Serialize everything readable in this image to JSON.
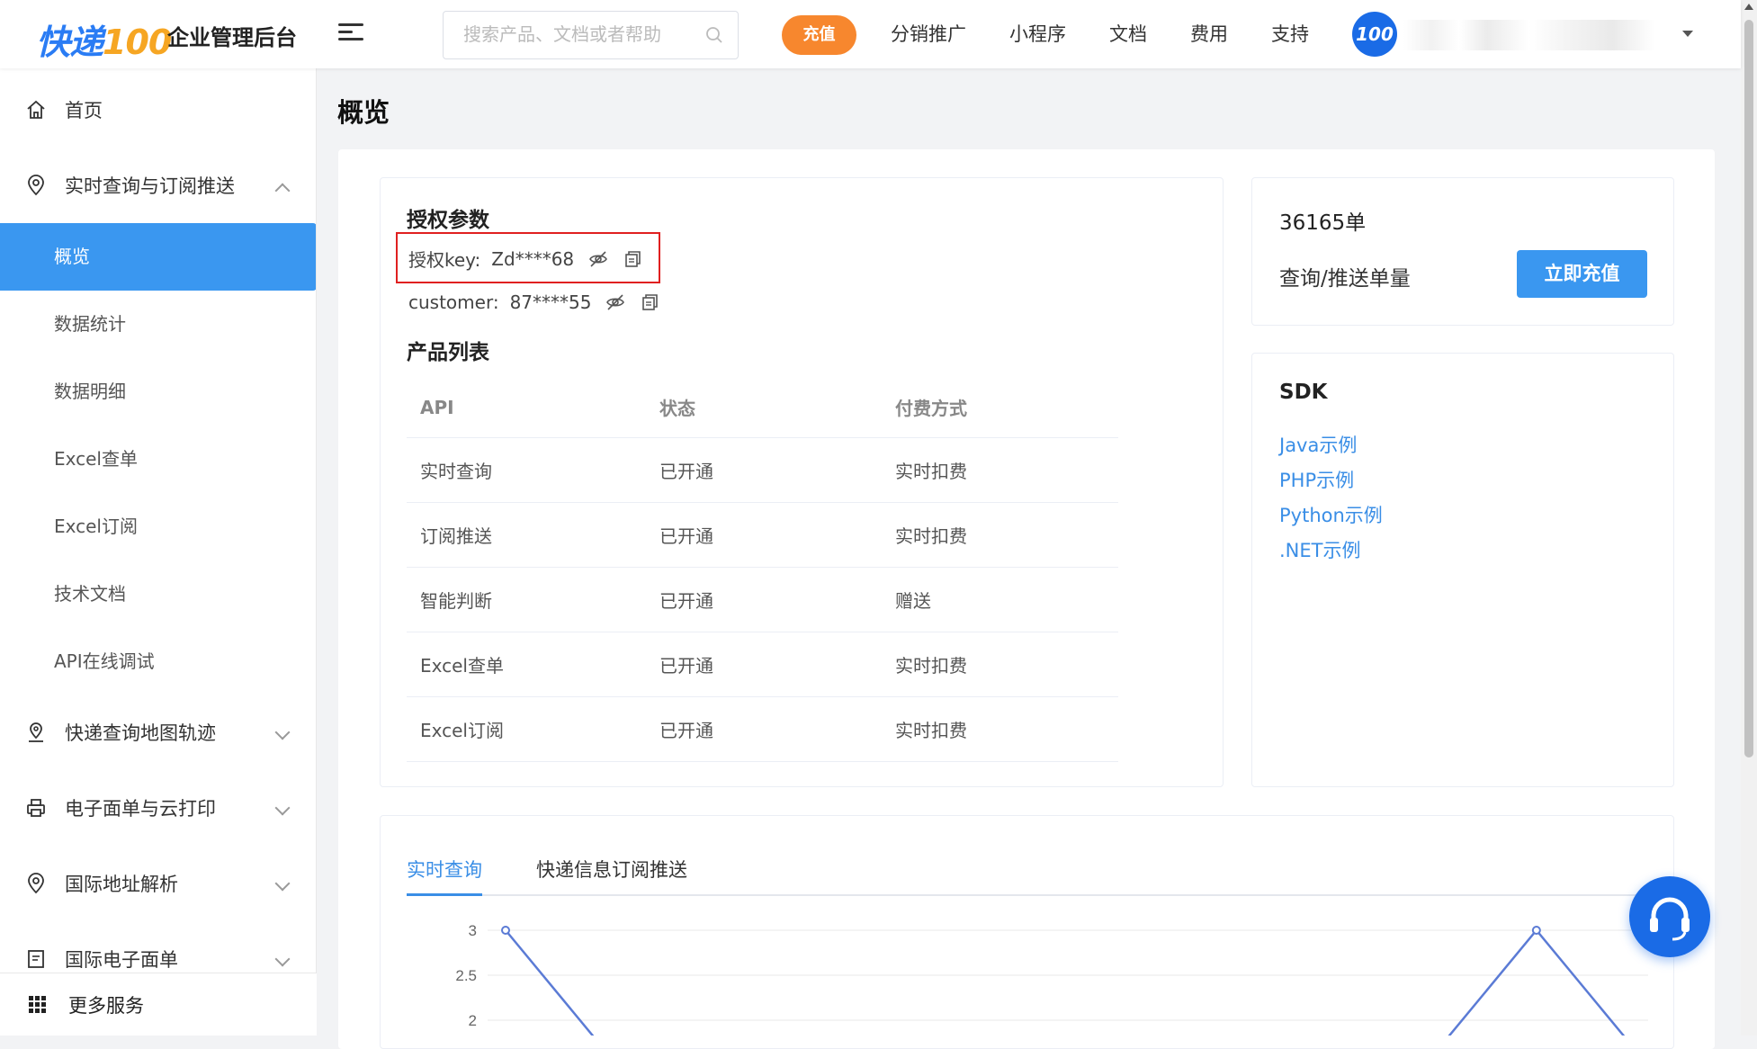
{
  "header": {
    "logo_main": "快递",
    "logo_num": "100",
    "app_title": "企业管理后台",
    "search_placeholder": "搜索产品、文档或者帮助",
    "recharge_label": "充值",
    "nav": [
      "分销推广",
      "小程序",
      "文档",
      "费用",
      "支持"
    ],
    "avatar_text": "100"
  },
  "sidebar": {
    "home": "首页",
    "section_realtime": "实时查询与订阅推送",
    "sub_items": [
      "概览",
      "数据统计",
      "数据明细",
      "Excel查单",
      "Excel订阅",
      "技术文档",
      "API在线调试"
    ],
    "section_map": "快递查询地图轨迹",
    "section_print": "电子面单与云打印",
    "section_intl_addr": "国际地址解析",
    "section_intl_waybill": "国际电子面单",
    "more_services": "更多服务"
  },
  "page": {
    "title": "概览"
  },
  "auth": {
    "title": "授权参数",
    "key_label": "授权key:",
    "key_value": "Zd****68",
    "customer_label": "customer:",
    "customer_value": "87****55"
  },
  "products": {
    "title": "产品列表",
    "columns": [
      "API",
      "状态",
      "付费方式"
    ],
    "rows": [
      [
        "实时查询",
        "已开通",
        "实时扣费"
      ],
      [
        "订阅推送",
        "已开通",
        "实时扣费"
      ],
      [
        "智能判断",
        "已开通",
        "赠送"
      ],
      [
        "Excel查单",
        "已开通",
        "实时扣费"
      ],
      [
        "Excel订阅",
        "已开通",
        "实时扣费"
      ]
    ]
  },
  "balance": {
    "count": "36165单",
    "label": "查询/推送单量",
    "button": "立即充值"
  },
  "sdk": {
    "title": "SDK",
    "links": [
      "Java示例",
      "PHP示例",
      "Python示例",
      ".NET示例"
    ]
  },
  "usage_tabs": [
    "实时查询",
    "快递信息订阅推送"
  ],
  "chart_data": {
    "type": "line",
    "y_ticks": [
      "3",
      "2.5",
      "2"
    ],
    "series": [
      {
        "values": [
          3,
          1.6,
          null,
          null,
          null,
          null,
          null,
          null,
          null,
          null,
          1.6,
          3,
          1.6
        ]
      }
    ],
    "ylim": [
      2,
      3
    ],
    "color": "#5b7bd5"
  },
  "colors": {
    "primary": "#3a97f0",
    "accent_orange": "#f7872e",
    "link": "#3a8ee6",
    "highlight": "#e02020"
  }
}
